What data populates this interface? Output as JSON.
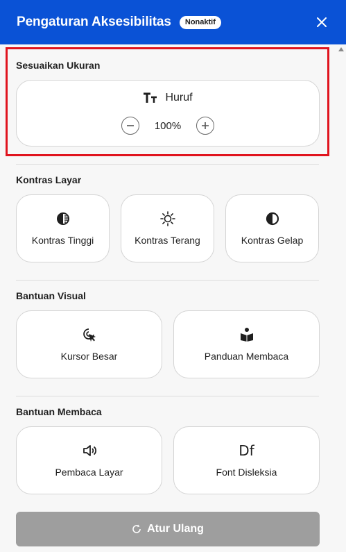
{
  "header": {
    "title": "Pengaturan Aksesibilitas",
    "status_badge": "Nonaktif",
    "close_icon": "close-icon"
  },
  "size_section": {
    "title": "Sesuaikan Ukuran",
    "font_label": "Huruf",
    "font_icon": "text-size-icon",
    "value": "100%",
    "decrease_icon": "minus-circle-icon",
    "increase_icon": "plus-circle-icon"
  },
  "contrast_section": {
    "title": "Kontras Layar",
    "items": [
      {
        "label": "Kontras Tinggi",
        "icon": "high-contrast-icon"
      },
      {
        "label": "Kontras Terang",
        "icon": "sun-icon"
      },
      {
        "label": "Kontras Gelap",
        "icon": "dark-contrast-icon"
      }
    ]
  },
  "visual_section": {
    "title": "Bantuan Visual",
    "items": [
      {
        "label": "Kursor Besar",
        "icon": "cursor-icon"
      },
      {
        "label": "Panduan Membaca",
        "icon": "reading-guide-icon"
      }
    ]
  },
  "reading_section": {
    "title": "Bantuan Membaca",
    "items": [
      {
        "label": "Pembaca Layar",
        "icon": "speaker-icon"
      },
      {
        "label": "Font Disleksia",
        "icon": "dyslexia-font-icon",
        "glyph": "Df"
      }
    ]
  },
  "reset_button": {
    "label": "Atur Ulang",
    "icon": "refresh-icon"
  },
  "colors": {
    "header_bg": "#0a52d6",
    "highlight_border": "#e0141e",
    "reset_bg": "#9e9e9e"
  }
}
